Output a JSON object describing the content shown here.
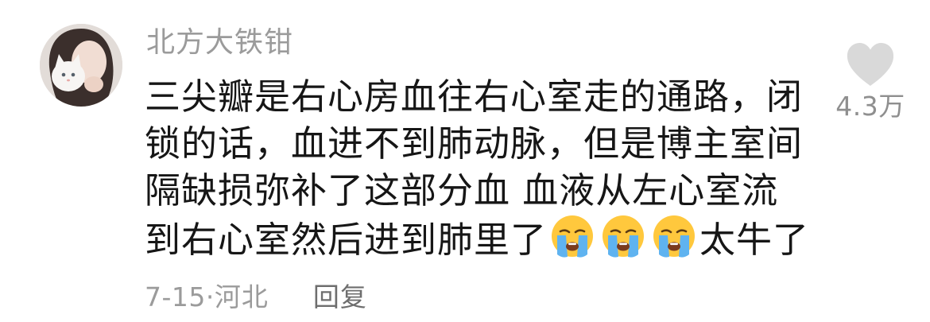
{
  "comment": {
    "author_name": "北方大铁钳",
    "text_part1": "三尖瓣是右心房血往右心室走的通路，闭锁的话，血进不到肺动脉，但是博主室间隔缺损弥补了这部分血 血液从左心室流到右心室然后进到肺里了",
    "text_part2": "太牛了",
    "emojis": [
      "loudly-crying-face-icon",
      "loudly-crying-face-icon",
      "loudly-crying-face-icon"
    ],
    "date": "7-15·",
    "location": "河北",
    "reply_label": "回复",
    "like_count": "4.3万"
  },
  "colors": {
    "author": "#9b9b9b",
    "text": "#161616",
    "meta": "#9b9b9b",
    "reply": "#6e6e6e",
    "heart": "#d9d9d9",
    "like_count": "#8f8f8f"
  }
}
